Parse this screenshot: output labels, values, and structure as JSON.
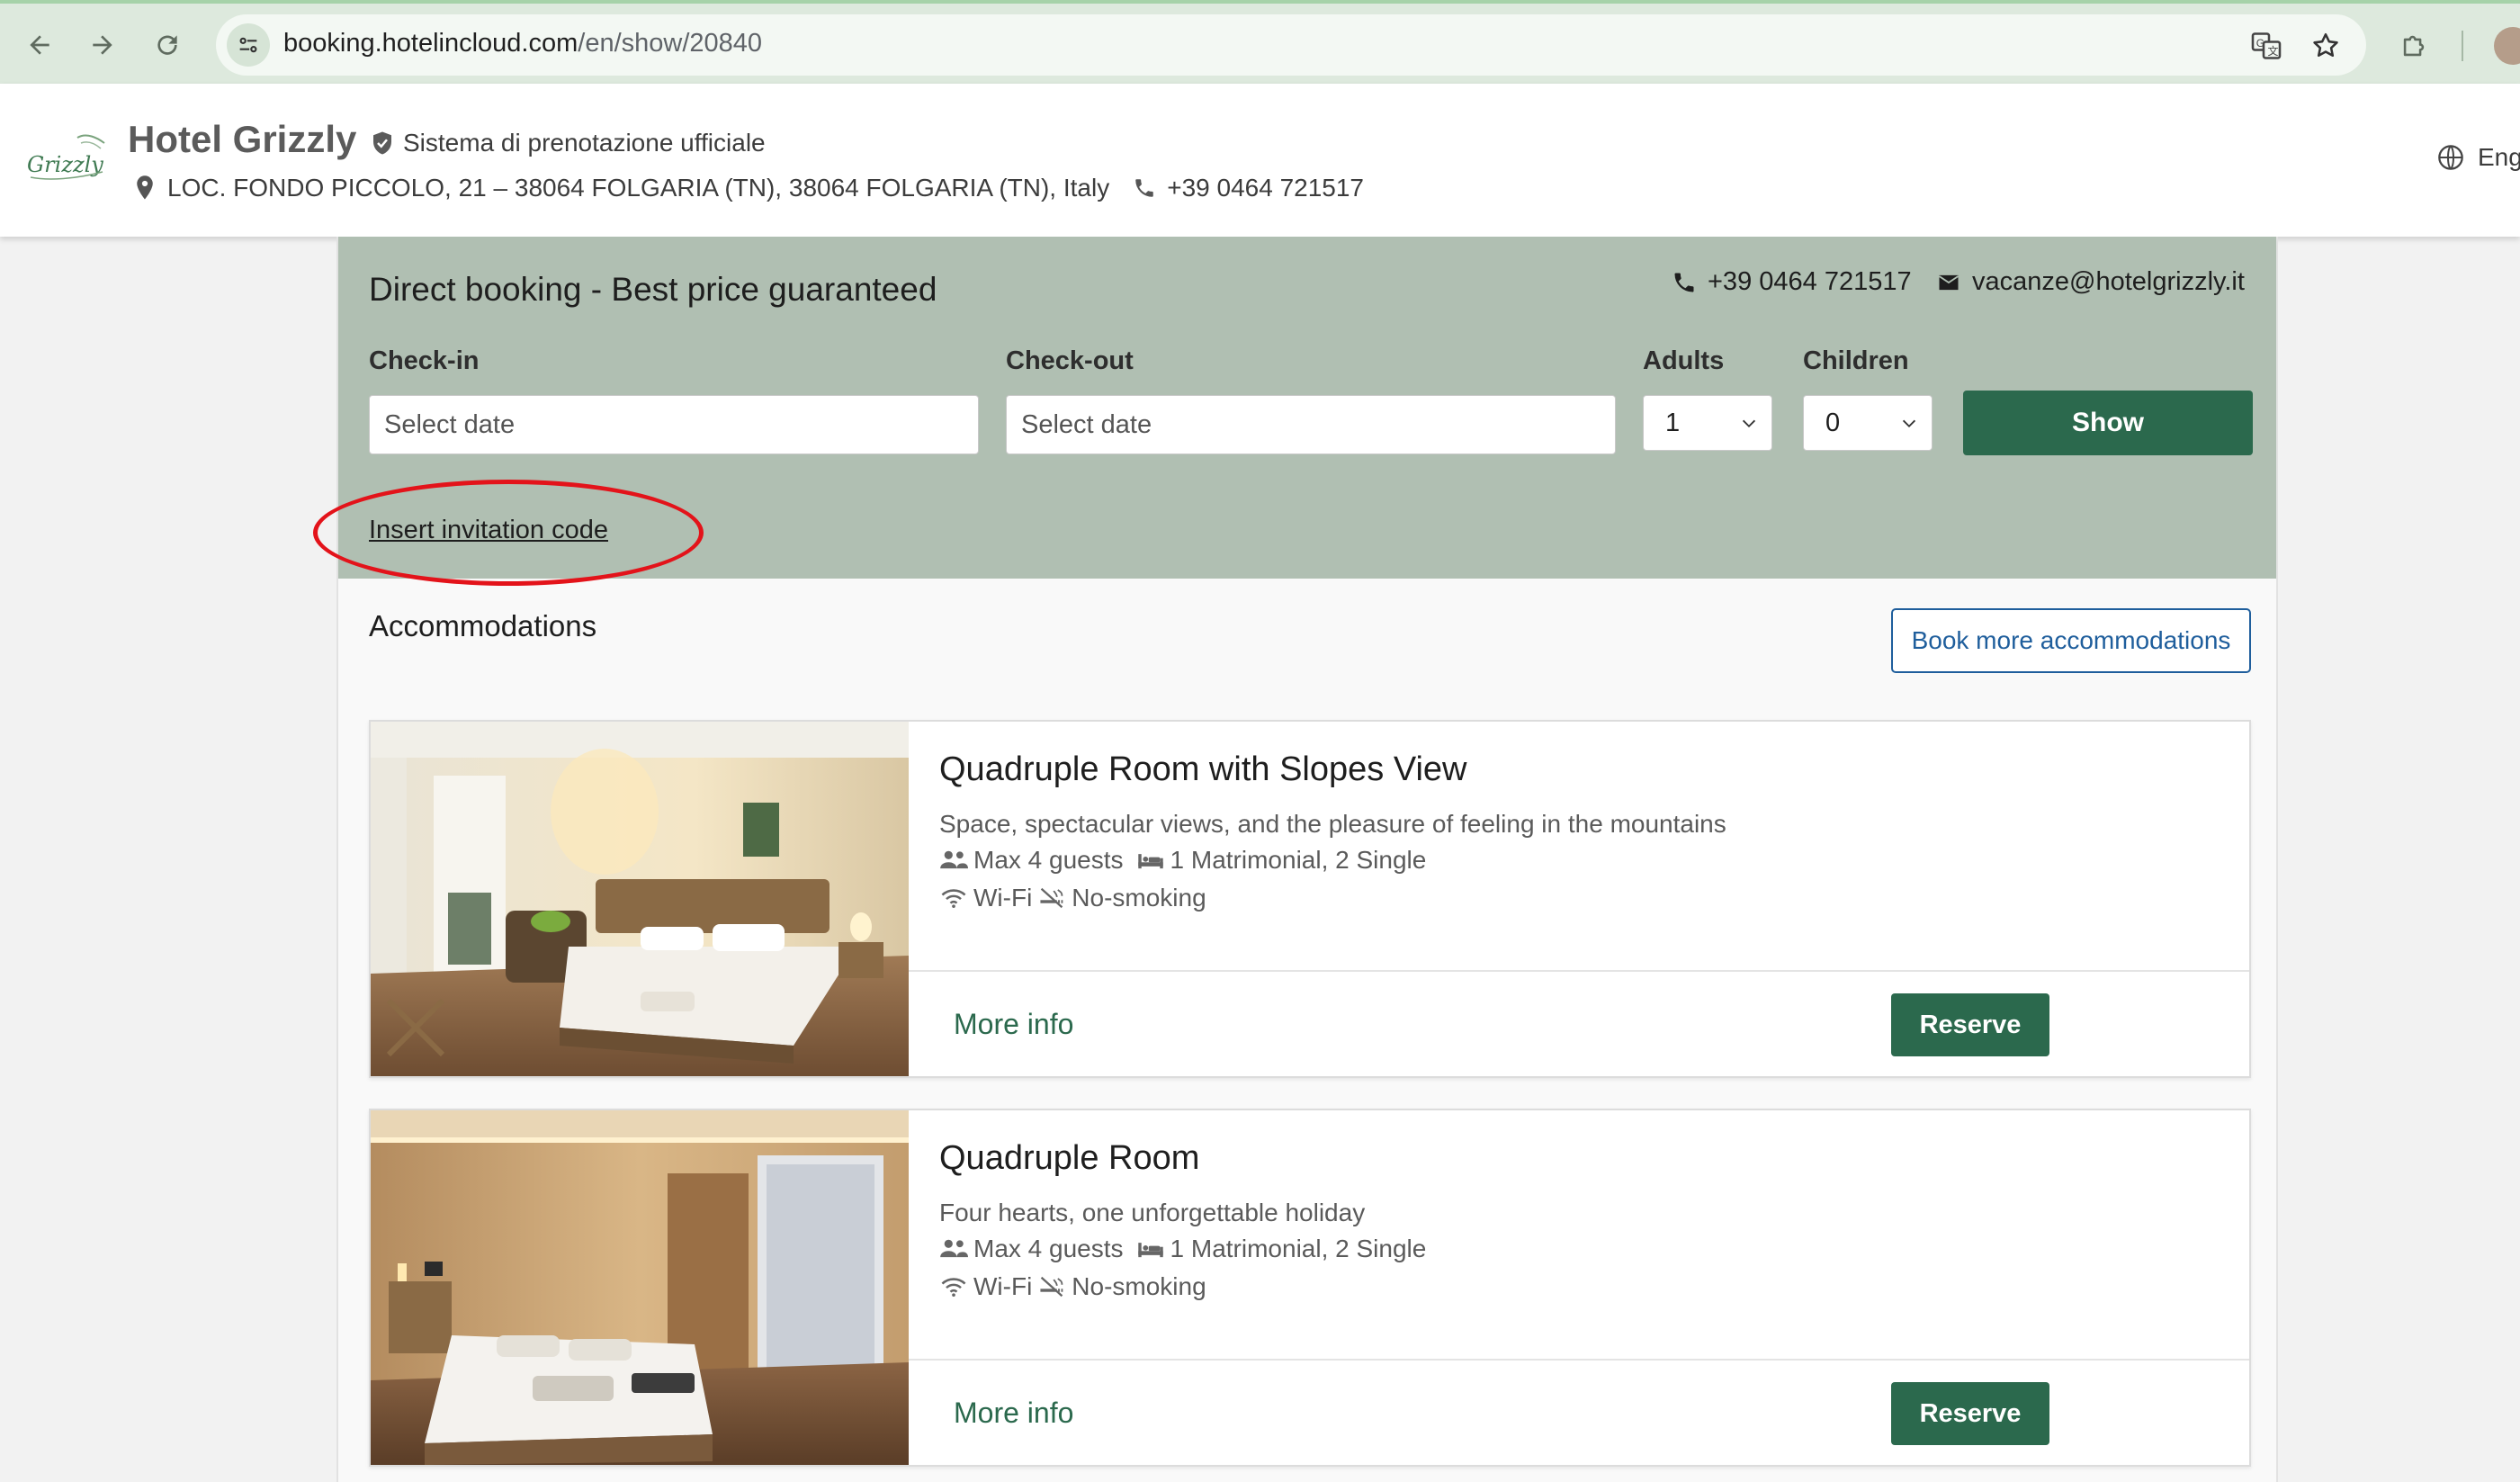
{
  "browser": {
    "url_domain": "booking.hotelincloud.com",
    "url_path": "/en/show/20840"
  },
  "header": {
    "hotel_name": "Hotel Grizzly",
    "logo_text": "Grizzly",
    "verified_text": "Sistema di prenotazione ufficiale",
    "address": "LOC. FONDO PICCOLO, 21 – 38064 FOLGARIA (TN), 38064 FOLGARIA (TN), Italy",
    "phone": "+39 0464 721517",
    "language": "Eng"
  },
  "booking": {
    "title": "Direct booking - Best price guaranteed",
    "phone": "+39 0464 721517",
    "email": "vacanze@hotelgrizzly.it",
    "checkin_label": "Check-in",
    "checkin_placeholder": "Select date",
    "checkout_label": "Check-out",
    "checkout_placeholder": "Select date",
    "adults_label": "Adults",
    "adults_value": "1",
    "children_label": "Children",
    "children_value": "0",
    "show_label": "Show",
    "invitation_label": "Insert invitation code"
  },
  "accommodations": {
    "title": "Accommodations",
    "book_more_label": "Book more accommodations",
    "rooms": [
      {
        "name": "Quadruple Room with Slopes View",
        "description": "Space, spectacular views, and the pleasure of feeling in the mountains",
        "guests": "Max 4 guests",
        "beds": "1 Matrimonial, 2 Single",
        "wifi": "Wi-Fi",
        "smoking": "No-smoking",
        "more_info_label": "More info",
        "reserve_label": "Reserve"
      },
      {
        "name": "Quadruple Room",
        "description": "Four hearts, one unforgettable holiday",
        "guests": "Max 4 guests",
        "beds": "1 Matrimonial, 2 Single",
        "wifi": "Wi-Fi",
        "smoking": "No-smoking",
        "more_info_label": "More info",
        "reserve_label": "Reserve"
      }
    ]
  },
  "colors": {
    "brand_green": "#2b694d",
    "panel_green": "#b0bfb2",
    "link_blue": "#1f5e9c",
    "annotation_red": "#e3131a"
  }
}
